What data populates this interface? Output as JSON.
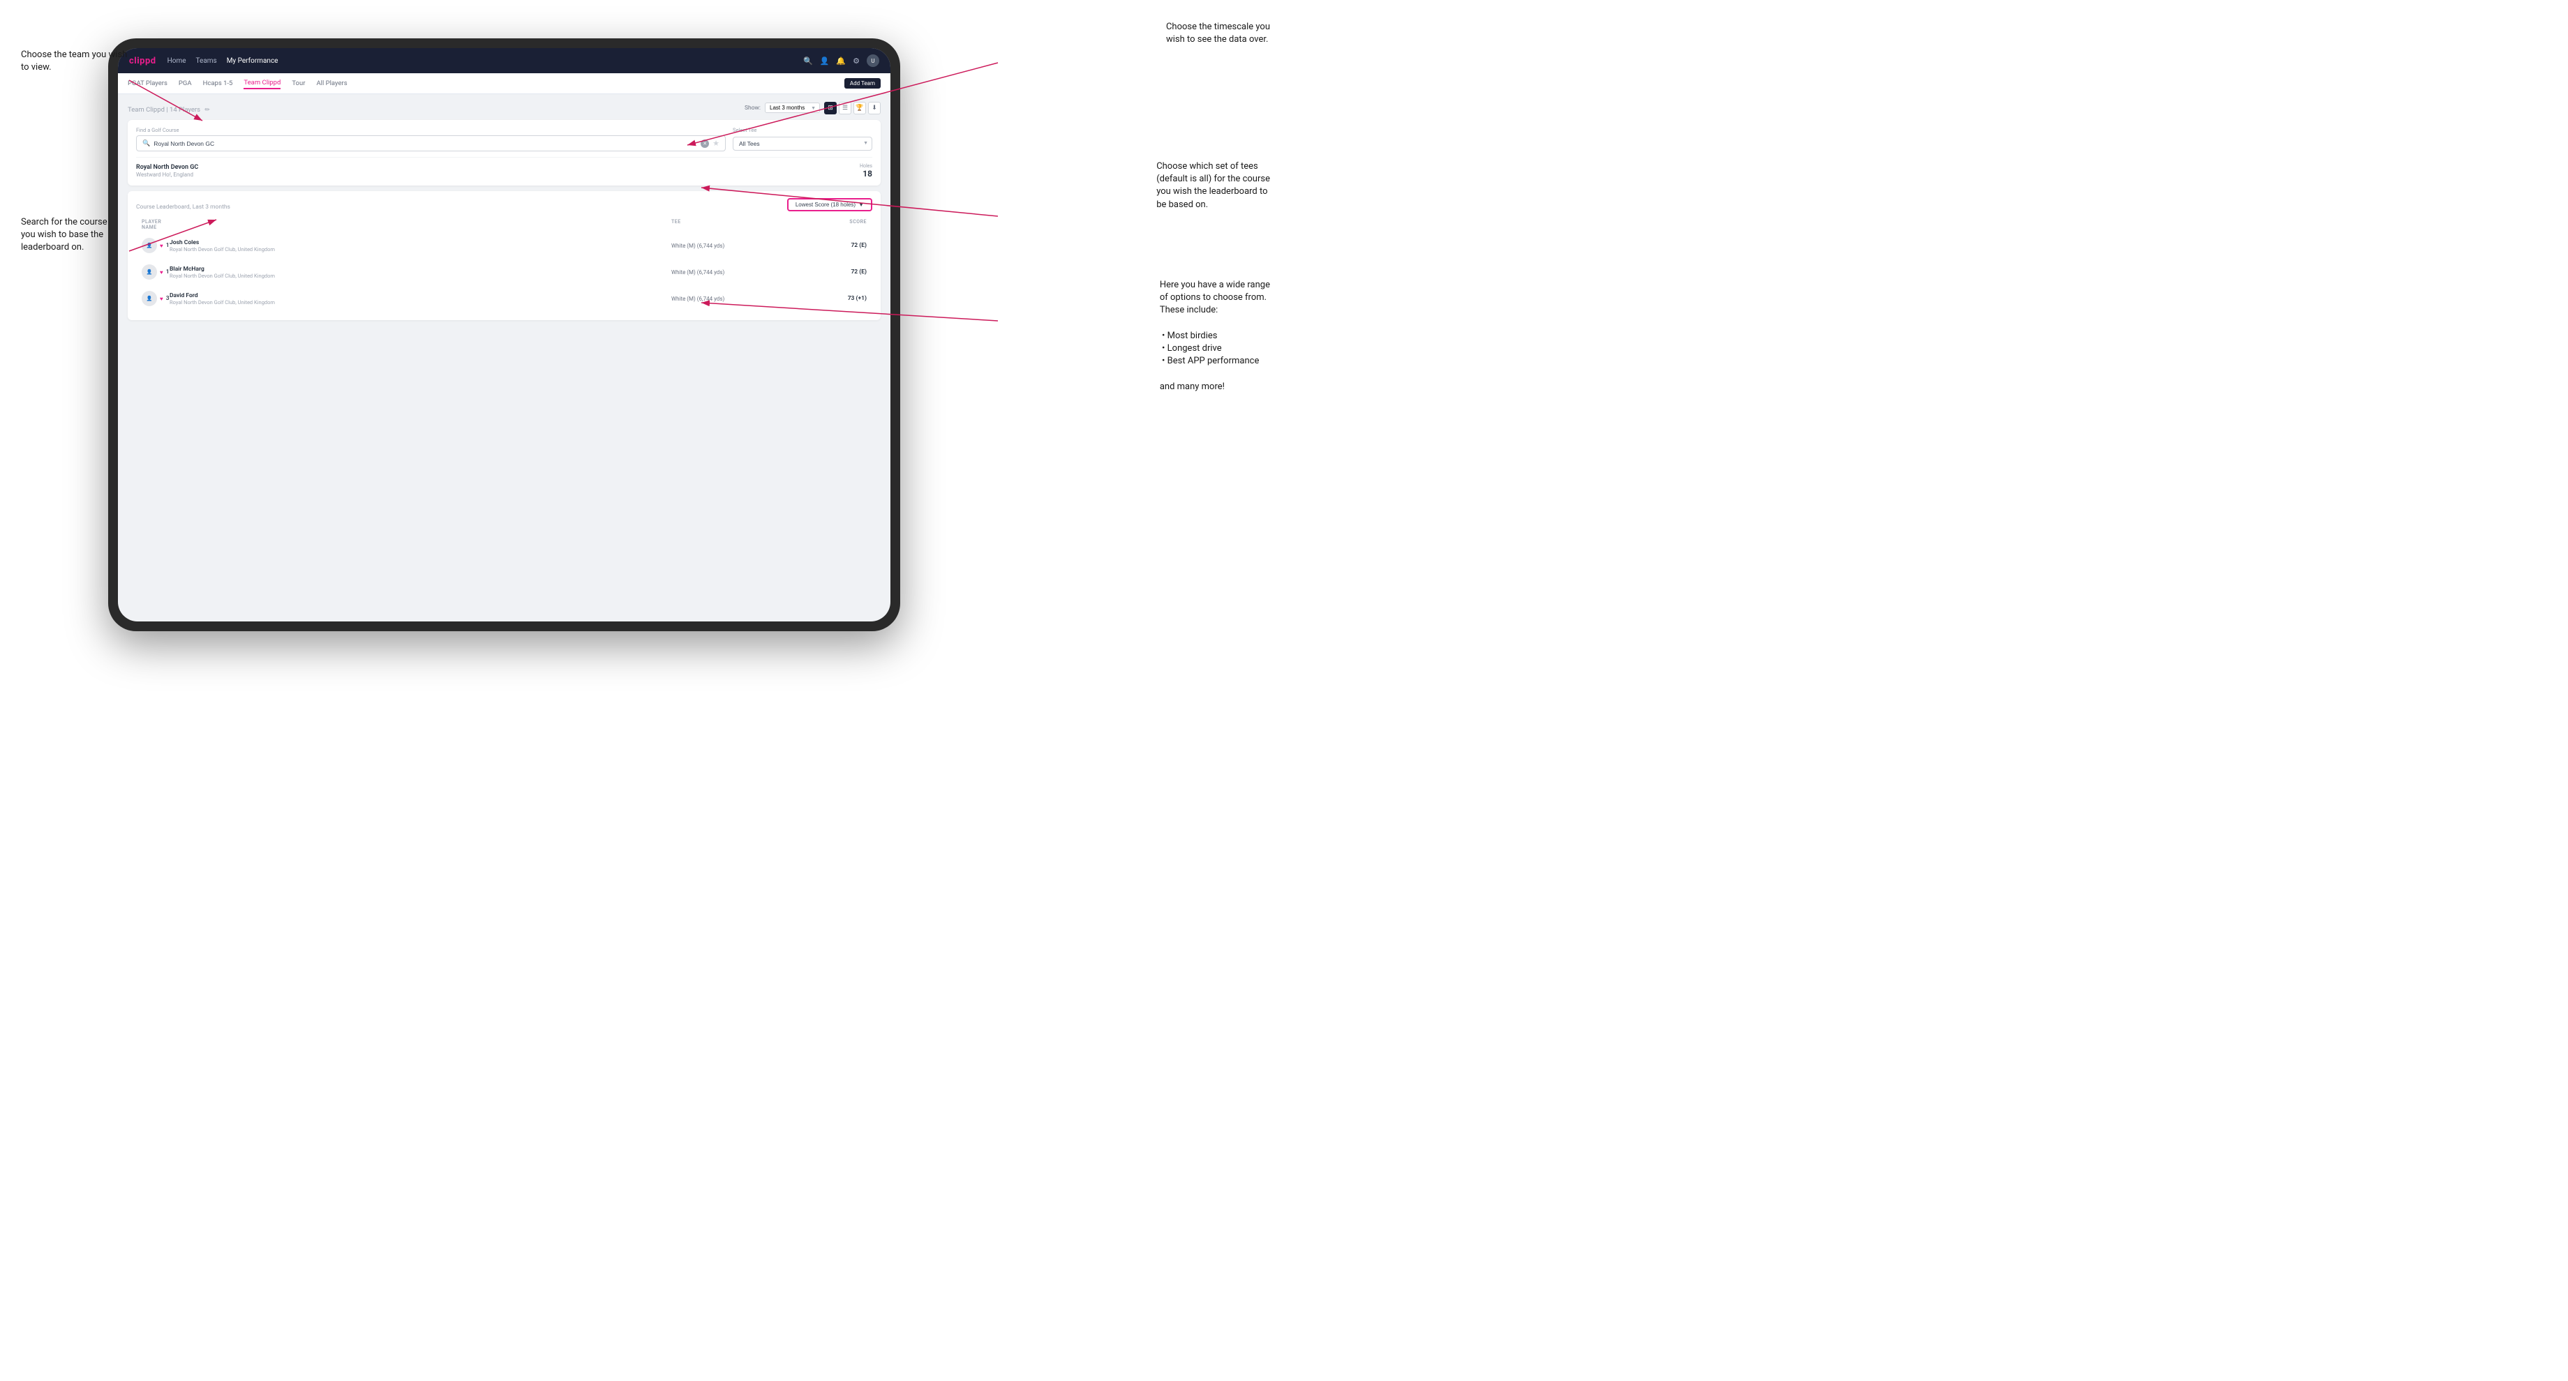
{
  "annotations": {
    "top_left_title": "Choose the team you\nwish to view.",
    "middle_left_title": "Search for the course\nyou wish to base the\nleaderboard on.",
    "top_right_title": "Choose the timescale you\nwish to see the data over.",
    "middle_right_title": "Choose which set of tees\n(default is all) for the course\nyou wish the leaderboard to\nbe based on.",
    "bottom_right_title": "Here you have a wide range\nof options to choose from.\nThese include:",
    "options_list": [
      "Most birdies",
      "Longest drive",
      "Best APP performance"
    ],
    "and_more": "and many more!"
  },
  "nav": {
    "logo": "clippd",
    "links": [
      "Home",
      "Teams",
      "My Performance"
    ],
    "active_link": "My Performance",
    "icons": [
      "search",
      "person",
      "bell",
      "settings",
      "avatar"
    ]
  },
  "sub_nav": {
    "items": [
      "PGAT Players",
      "PGA",
      "Hcaps 1-5",
      "Team Clippd",
      "Tour",
      "All Players"
    ],
    "active_item": "Team Clippd",
    "add_team_btn": "Add Team"
  },
  "team_header": {
    "title": "Team Clippd",
    "player_count": "14 Players",
    "show_label": "Show:",
    "show_value": "Last 3 months"
  },
  "search": {
    "find_label": "Find a Golf Course",
    "placeholder": "Royal North Devon GC",
    "tee_label": "Select Tee",
    "tee_value": "All Tees"
  },
  "course": {
    "name": "Royal North Devon GC",
    "location": "Westward Ho!, England",
    "holes_label": "Holes",
    "holes": "18"
  },
  "leaderboard": {
    "title": "Course Leaderboard,",
    "subtitle": "Last 3 months",
    "score_type": "Lowest Score (18 holes)",
    "columns": {
      "player_name": "PLAYER NAME",
      "tee": "TEE",
      "score": "SCORE"
    },
    "players": [
      {
        "rank": "1",
        "name": "Josh Coles",
        "club": "Royal North Devon Golf Club, United Kingdom",
        "tee": "White (M) (6,744 yds)",
        "score": "72 (E)"
      },
      {
        "rank": "1",
        "name": "Blair McHarg",
        "club": "Royal North Devon Golf Club, United Kingdom",
        "tee": "White (M) (6,744 yds)",
        "score": "72 (E)"
      },
      {
        "rank": "3",
        "name": "David Ford",
        "club": "Royal North Devon Golf Club, United Kingdom",
        "tee": "White (M) (6,744 yds)",
        "score": "73 (+1)"
      }
    ]
  }
}
